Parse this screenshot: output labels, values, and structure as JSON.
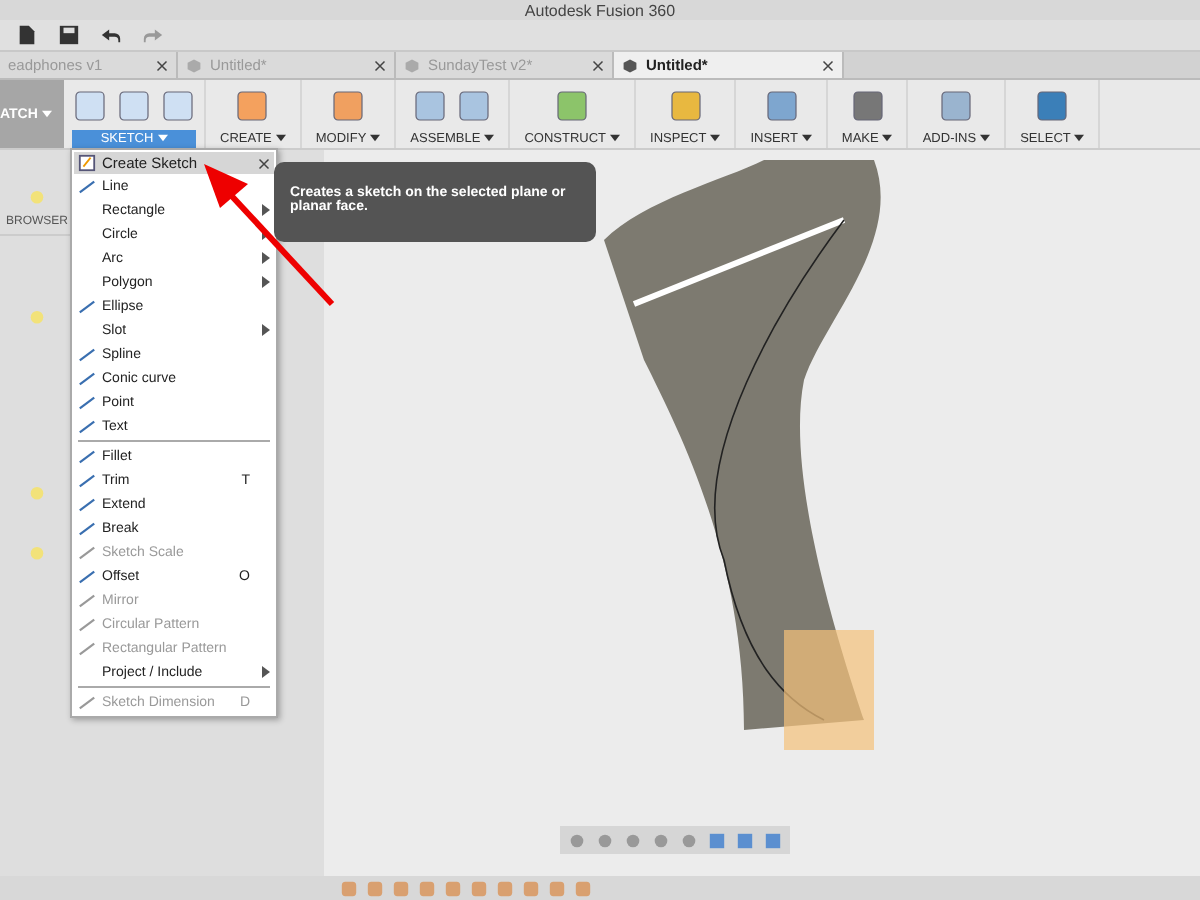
{
  "window": {
    "title": "Autodesk Fusion 360"
  },
  "tabs": [
    {
      "label": "eadphones v1",
      "selected": false
    },
    {
      "label": "Untitled*",
      "selected": false
    },
    {
      "label": "SundayTest v2*",
      "selected": false
    },
    {
      "label": "Untitled*",
      "selected": true
    }
  ],
  "workspace": {
    "label": "ATCH"
  },
  "ribbon": [
    {
      "label": "SKETCH",
      "selected": true
    },
    {
      "label": "CREATE",
      "selected": false
    },
    {
      "label": "MODIFY",
      "selected": false
    },
    {
      "label": "ASSEMBLE",
      "selected": false
    },
    {
      "label": "CONSTRUCT",
      "selected": false
    },
    {
      "label": "INSPECT",
      "selected": false
    },
    {
      "label": "INSERT",
      "selected": false
    },
    {
      "label": "MAKE",
      "selected": false
    },
    {
      "label": "ADD-INS",
      "selected": false
    },
    {
      "label": "SELECT",
      "selected": false
    }
  ],
  "browser": {
    "title": "BROWSER"
  },
  "menu": {
    "header": "Create Sketch",
    "items": [
      {
        "label": "Line",
        "icon": true,
        "submenu": false,
        "disabled": false,
        "divider_before": false
      },
      {
        "label": "Rectangle",
        "icon": false,
        "submenu": true,
        "disabled": false,
        "divider_before": false
      },
      {
        "label": "Circle",
        "icon": false,
        "submenu": true,
        "disabled": false,
        "divider_before": false
      },
      {
        "label": "Arc",
        "icon": false,
        "submenu": true,
        "disabled": false,
        "divider_before": false
      },
      {
        "label": "Polygon",
        "icon": false,
        "submenu": true,
        "disabled": false,
        "divider_before": false
      },
      {
        "label": "Ellipse",
        "icon": true,
        "submenu": false,
        "disabled": false,
        "divider_before": false
      },
      {
        "label": "Slot",
        "icon": false,
        "submenu": true,
        "disabled": false,
        "divider_before": false
      },
      {
        "label": "Spline",
        "icon": true,
        "submenu": false,
        "disabled": false,
        "divider_before": false
      },
      {
        "label": "Conic curve",
        "icon": true,
        "submenu": false,
        "disabled": false,
        "divider_before": false
      },
      {
        "label": "Point",
        "icon": true,
        "submenu": false,
        "disabled": false,
        "divider_before": false
      },
      {
        "label": "Text",
        "icon": true,
        "submenu": false,
        "disabled": false,
        "divider_before": false
      },
      {
        "label": "Fillet",
        "icon": true,
        "submenu": false,
        "disabled": false,
        "divider_before": true
      },
      {
        "label": "Trim",
        "icon": true,
        "submenu": false,
        "disabled": false,
        "divider_before": false,
        "shortcut": "T"
      },
      {
        "label": "Extend",
        "icon": true,
        "submenu": false,
        "disabled": false,
        "divider_before": false
      },
      {
        "label": "Break",
        "icon": true,
        "submenu": false,
        "disabled": false,
        "divider_before": false
      },
      {
        "label": "Sketch Scale",
        "icon": true,
        "submenu": false,
        "disabled": true,
        "divider_before": false
      },
      {
        "label": "Offset",
        "icon": true,
        "submenu": false,
        "disabled": false,
        "divider_before": false,
        "shortcut": "O"
      },
      {
        "label": "Mirror",
        "icon": true,
        "submenu": false,
        "disabled": true,
        "divider_before": false
      },
      {
        "label": "Circular Pattern",
        "icon": true,
        "submenu": false,
        "disabled": true,
        "divider_before": false
      },
      {
        "label": "Rectangular Pattern",
        "icon": true,
        "submenu": false,
        "disabled": true,
        "divider_before": false
      },
      {
        "label": "Project / Include",
        "icon": false,
        "submenu": true,
        "disabled": false,
        "divider_before": false
      },
      {
        "label": "Sketch Dimension",
        "icon": true,
        "submenu": false,
        "disabled": true,
        "divider_before": true,
        "shortcut": "D"
      }
    ]
  },
  "tooltip": {
    "text": "Creates a sketch on the selected plane or planar face."
  }
}
